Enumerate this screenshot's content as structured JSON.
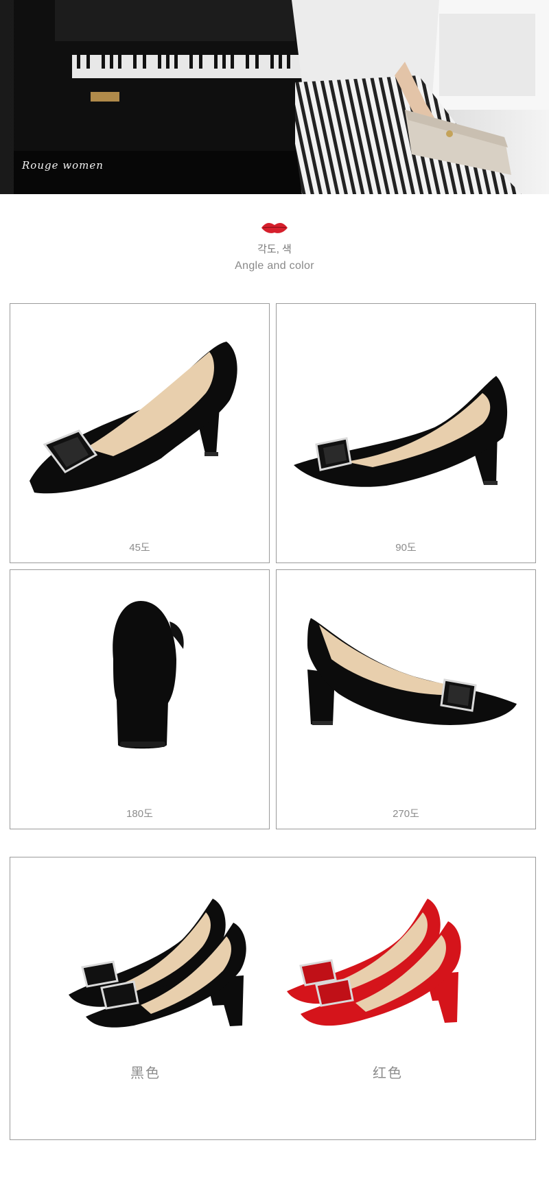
{
  "hero": {
    "logo_text": "Rouge women"
  },
  "section": {
    "icon": "lips-icon",
    "title_ko": "각도, 색",
    "title_en": "Angle and color"
  },
  "angles": [
    {
      "label": "45도"
    },
    {
      "label": "90도"
    },
    {
      "label": "180도"
    },
    {
      "label": "270도"
    }
  ],
  "colors": [
    {
      "label": "黑色",
      "swatch": "#0c0c0c"
    },
    {
      "label": "红色",
      "swatch": "#d5141b"
    }
  ],
  "palette": {
    "border": "#9a9a9a",
    "shoe_black": "#0c0c0c",
    "shoe_red": "#d5141b",
    "lining": "#e8cfad",
    "lips": "#d61f2c"
  }
}
